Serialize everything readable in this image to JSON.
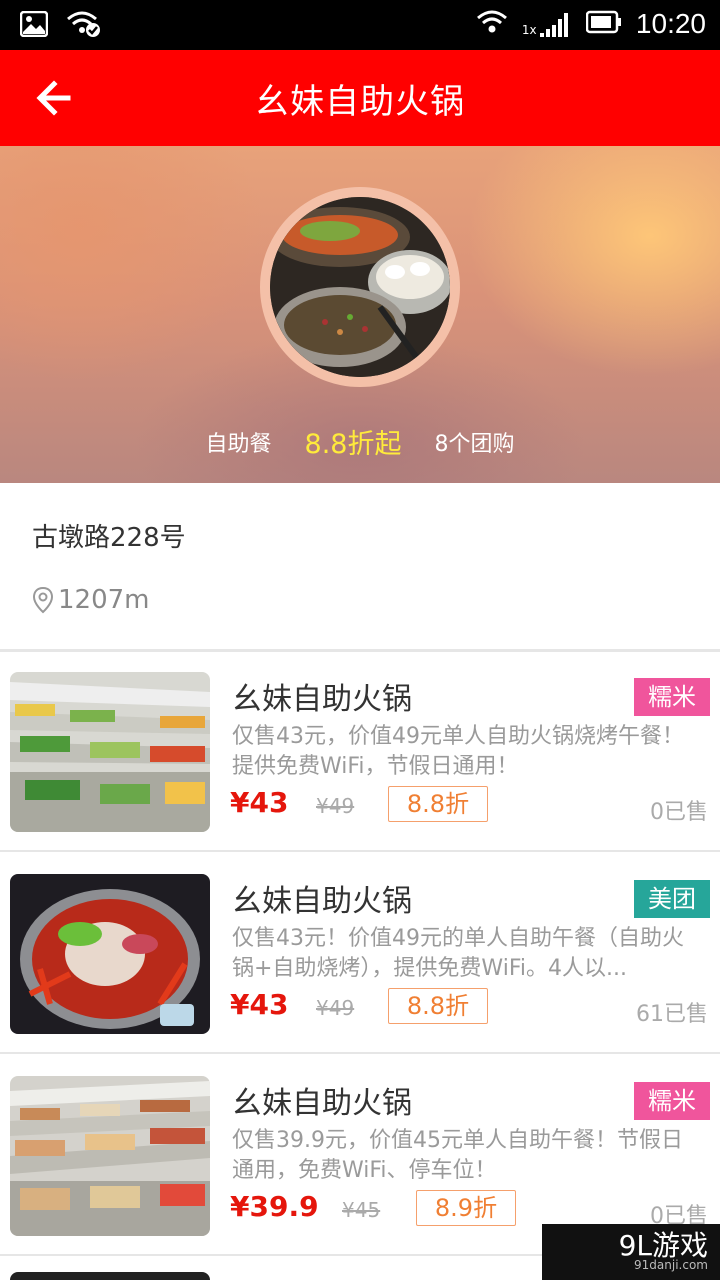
{
  "status_bar": {
    "time": "10:20",
    "signal_label": "1x",
    "icons": [
      "image-icon",
      "wifi-check-icon",
      "wifi-icon",
      "signal-icon",
      "battery-icon"
    ]
  },
  "header": {
    "title": "幺妹自助火锅",
    "back_icon": "arrow-left-icon",
    "background": "#ff0000"
  },
  "hero": {
    "category": "自助餐",
    "discount": "8.8折起",
    "group_count": "8个团购"
  },
  "info": {
    "address": "古墩路228号",
    "distance": "1207m",
    "location_icon": "location-pin-icon"
  },
  "deals": [
    {
      "name": "幺妹自助火锅",
      "badge": "糯米",
      "badge_color": "#f0559c",
      "description": "仅售43元，价值49元单人自助火锅烧烤午餐！提供免费WiFi，节假日通用！",
      "price": "¥43",
      "original_price": "¥49",
      "discount": "8.8折",
      "sold": "0已售"
    },
    {
      "name": "幺妹自助火锅",
      "badge": "美团",
      "badge_color": "#26a69a",
      "description": "仅售43元！价值49元的单人自助午餐（自助火锅+自助烧烤），提供免费WiFi。4人以...",
      "price": "¥43",
      "original_price": "¥49",
      "discount": "8.8折",
      "sold": "61已售"
    },
    {
      "name": "幺妹自助火锅",
      "badge": "糯米",
      "badge_color": "#f0559c",
      "description": "仅售39.9元，价值45元单人自助午餐！节假日通用，免费WiFi、停车位！",
      "price": "¥39.9",
      "original_price": "¥45",
      "discount": "8.9折",
      "sold": "0已售"
    }
  ],
  "watermark": {
    "brand": "9L游戏",
    "url": "91danji.com"
  }
}
